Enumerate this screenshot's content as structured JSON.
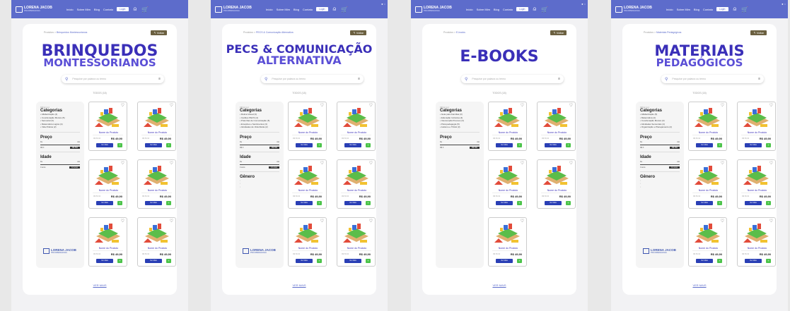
{
  "nav": {
    "logo_name": "LORENA JACOB",
    "logo_sub": "PSICOPEDAGOGIA",
    "menu": [
      "Início",
      "Sobre Mim",
      "Blog",
      "Contato"
    ],
    "login": "Login",
    "user_icon": "user-icon",
    "cart_icon": "cart-icon"
  },
  "colors": {
    "nav": "#5d6ccb",
    "title_primary": "#3a2fb8",
    "title_secondary": "#5b4fd6",
    "buy_button": "#2a3fb5",
    "cart_button": "#4cc34a",
    "back_button": "#6b6040"
  },
  "common": {
    "crumb_root": "Produtos",
    "back": "Voltar",
    "search_placeholder": "Pesquise por palavra ou termo",
    "todos": "TODOS (18)",
    "categorias_small": "Filtrar por",
    "categorias": "Categorias",
    "preco": "Preço",
    "idade": "Idade",
    "genero": "Gênero",
    "de": "De",
    "ate": "Até",
    "min": "R$ 0",
    "max": "R$ 500",
    "idade_min": "0 anos",
    "idade_max": "12 anos",
    "product_name": "Nome do Produto",
    "old_price": "R$ 59,90",
    "price": "R$ 49,90",
    "buy": "Ver Mais",
    "ver_mais": "VER MAIS"
  },
  "boards": [
    {
      "crumb": "Brinquedos Montessorianos",
      "title1": "BRINQUEDOS",
      "title2": "MONTESSORIANOS",
      "categories": [
        "Alfabetização (4)",
        "Coordenação Motora (5)",
        "Sensorial (3)",
        "Matemática Lógica (4)",
        "Vida Prática (2)"
      ],
      "filters": [
        "preco",
        "idade"
      ],
      "cards": 6
    },
    {
      "crumb": "PECS & Comunicação Alternativa",
      "title1": "PECS & COMUNICAÇÃO",
      "title2": "ALTERNATIVA",
      "categories": [
        "Rotina Visual (3)",
        "Cartões PECS (4)",
        "Pranchas de Comunicação (5)",
        "Emoções e Sentimentos (3)",
        "Atividades de Vida Diária (2)"
      ],
      "filters": [
        "preco",
        "idade",
        "genero"
      ],
      "cards": 6
    },
    {
      "crumb": "E-books",
      "title1": "E-BOOKS",
      "title2": "",
      "categories": [
        "Guia para Famílias (3)",
        "Educação Inclusiva (4)",
        "Intervenção Precoce (3)",
        "Psicopedagogia (5)",
        "Autismo e TDAH (3)"
      ],
      "filters": [
        "preco"
      ],
      "cards": 5
    },
    {
      "crumb": "Materiais Pedagógicos",
      "title1": "MATERIAIS",
      "title2": "PEDAGÓGICOS",
      "categories": [
        "Alfabetização (5)",
        "Matemática (4)",
        "Coordenação Motora (3)",
        "Atividades Sensoriais (4)",
        "Organização e Planejamento (2)"
      ],
      "filters": [
        "preco",
        "idade",
        "genero"
      ],
      "cards": 6
    }
  ]
}
